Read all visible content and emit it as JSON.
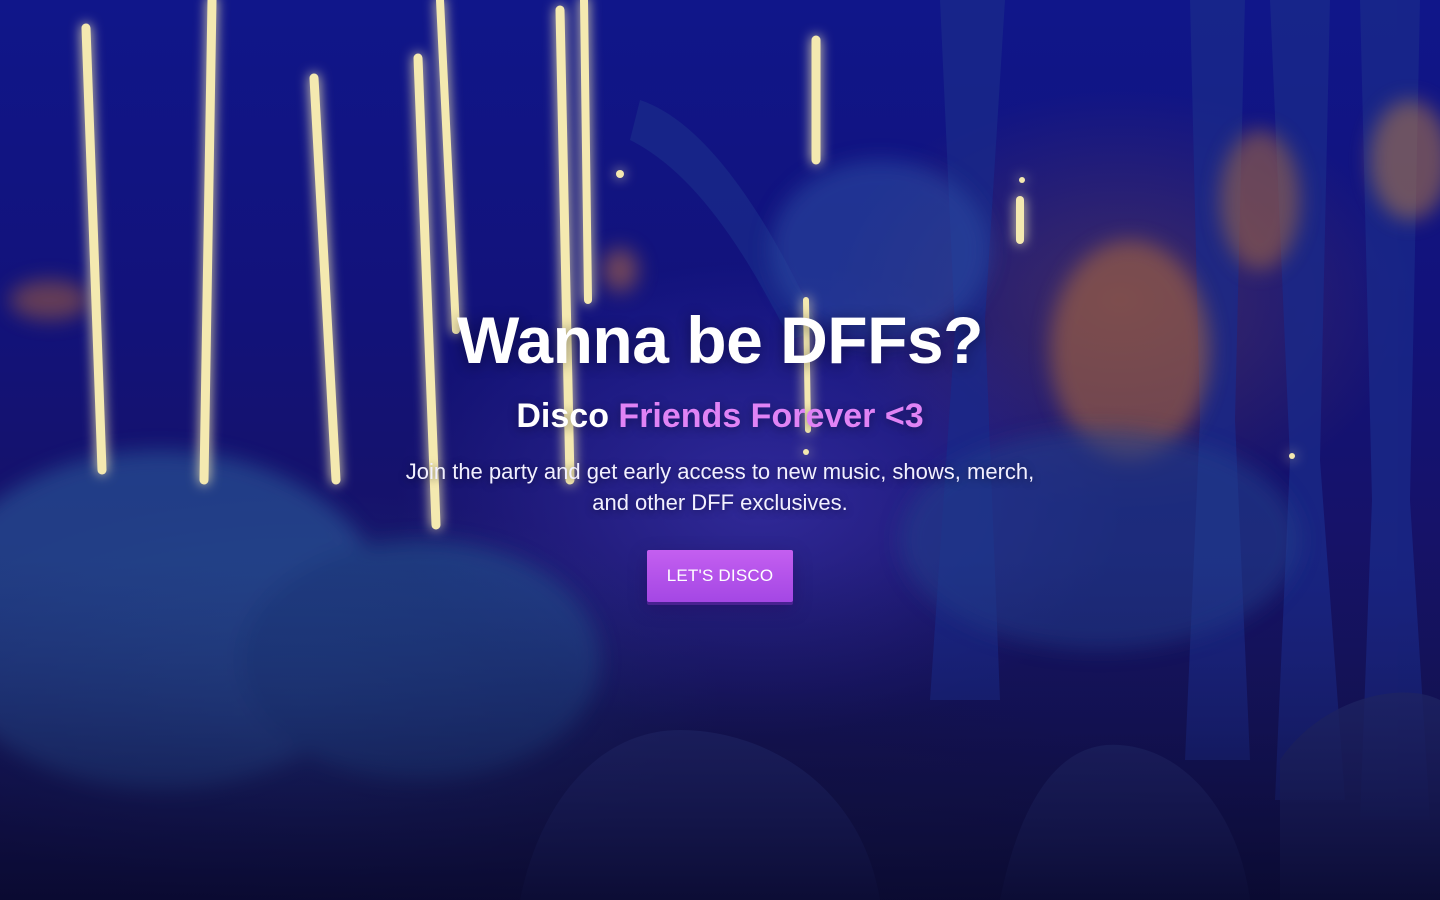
{
  "hero": {
    "title": "Wanna be DFFs?",
    "subtitle_plain": "Disco",
    "subtitle_accent": "Friends Forever <3",
    "description": "Join the party and get early access to new music, shows, merch, and other DFF exclusives.",
    "cta_label": "LET'S DISCO"
  },
  "colors": {
    "accent": "#e083f5",
    "button": "#b653ea",
    "background": "#12127a",
    "text": "#ffffff"
  }
}
